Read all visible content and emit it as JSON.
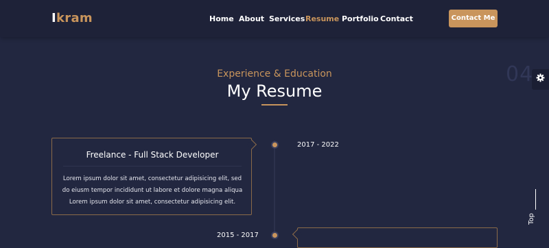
{
  "brand": {
    "first_letter": "I",
    "rest": "kram"
  },
  "nav": {
    "items": [
      {
        "label": "Home"
      },
      {
        "label": "About"
      },
      {
        "label": "Services"
      },
      {
        "label": "Resume",
        "active": true
      },
      {
        "label": "Portfolio"
      },
      {
        "label": "Contact"
      }
    ],
    "cta_label": "Contact Me"
  },
  "section": {
    "number": "04",
    "subtitle": "Experience & Education",
    "title": "My Resume"
  },
  "timeline": [
    {
      "date": "2017 - 2022",
      "title": "Freelance - Full Stack Developer",
      "description": "Lorem ipsum dolor sit amet, consectetur adipisicing elit, sed do eiusm tempor incididunt ut labore et dolore magna aliqua Lorem ipsum dolor sit amet, consectetur adipisicing elit."
    },
    {
      "date": "2015 - 2017"
    }
  ],
  "scroll_top": {
    "label": "Top"
  },
  "colors": {
    "background": "#222740",
    "navbar": "#1e2238",
    "accent": "#c9955c",
    "text": "#ffffff"
  },
  "icons": {
    "settings": "gear-icon"
  }
}
